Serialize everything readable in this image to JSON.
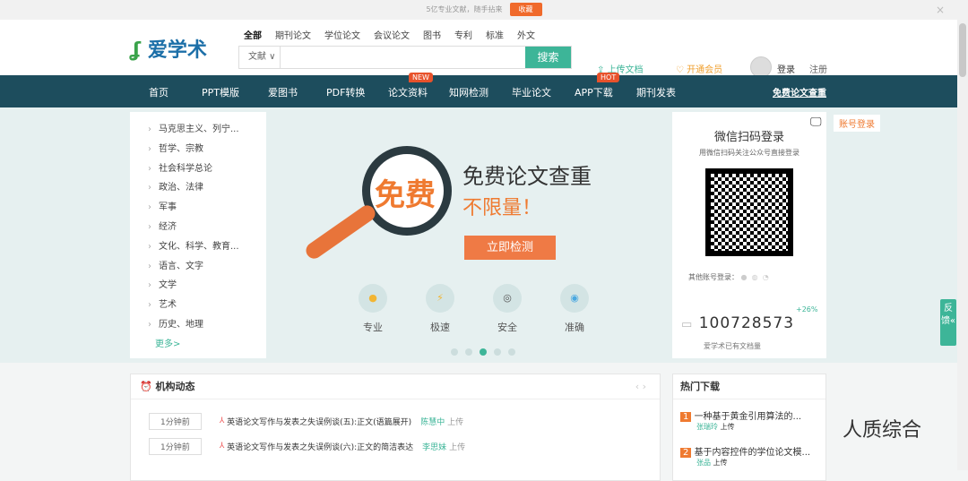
{
  "topbar": {
    "slogan": "5亿专业文献，随手拈来",
    "fav": "收藏",
    "close": "×"
  },
  "header": {
    "logo": "爱学术",
    "cats": [
      "全部",
      "期刊论文",
      "学位论文",
      "会议论文",
      "图书",
      "专利",
      "标准",
      "外文"
    ],
    "search_type": "文献 ∨",
    "search_btn": "搜索",
    "upload": "上传文档",
    "vip": "开通会员",
    "login": "登录",
    "register": "注册"
  },
  "nav": {
    "items": [
      "首页",
      "PPT模版",
      "爱图书",
      "PDF转换",
      "论文资料",
      "知网检测",
      "毕业论文",
      "APP下载",
      "期刊发表"
    ],
    "new": "NEW",
    "hot": "HOT",
    "right": "免费论文查重"
  },
  "categories": [
    "马克思主义、列宁...",
    "哲学、宗教",
    "社会科学总论",
    "政治、法律",
    "军事",
    "经济",
    "文化、科学、教育...",
    "语言、文字",
    "文学",
    "艺术",
    "历史、地理"
  ],
  "more": "更多>",
  "promo": {
    "big": "免费",
    "title": "免费论文查重",
    "sub": "不限量！",
    "btn": "立即检测",
    "features": [
      "专业",
      "极速",
      "安全",
      "准确"
    ]
  },
  "login": {
    "title": "微信扫码登录",
    "sub": "用微信扫码关注公众号直接登录",
    "account_tab": "账号登录",
    "other": "其他账号登录：",
    "count": "100728573",
    "growth": "+26%",
    "count_label": "爱学术已有文档量"
  },
  "feedback": "反馈«",
  "news": {
    "title": "机构动态",
    "rows": [
      {
        "time": "1分钟前",
        "title": "英语论文写作与发表之失误例谈(五):正文(语篇展开)",
        "user": "陈慧中",
        "action": "上传"
      },
      {
        "time": "1分钟前",
        "title": "英语论文写作与发表之失误例谈(六):正文的简洁表达",
        "user": "李思妹",
        "action": "上传"
      }
    ]
  },
  "hot": {
    "title": "热门下载",
    "items": [
      {
        "rank": "1",
        "title": "一种基于黄金引用算法的...",
        "user": "张瑞玲",
        "action": "上传"
      },
      {
        "rank": "2",
        "title": "基于内容控件的学位论文模...",
        "user": "张品",
        "action": "上传"
      }
    ]
  },
  "watermark": "人质综合"
}
